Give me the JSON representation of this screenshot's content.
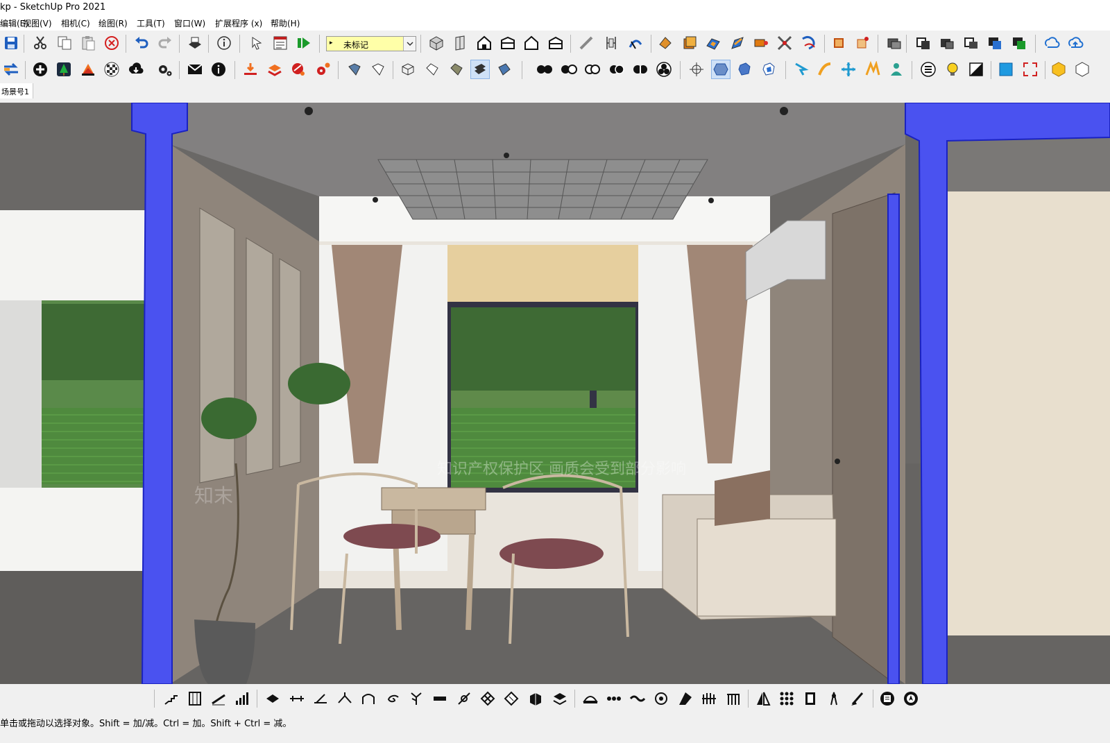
{
  "window": {
    "title": "kp - SketchUp Pro 2021"
  },
  "menu": {
    "items": [
      {
        "label": "编辑(E)"
      },
      {
        "label": "视图(V)"
      },
      {
        "label": "相机(C)"
      },
      {
        "label": "绘图(R)"
      },
      {
        "label": "工具(T)"
      },
      {
        "label": "窗口(W)"
      },
      {
        "label": "扩展程序 (x)"
      },
      {
        "label": "帮助(H)"
      }
    ]
  },
  "toolbar": {
    "layer_value": "未标记"
  },
  "scene_tabs": [
    {
      "label": "场景号1"
    }
  ],
  "viewport": {
    "watermark_banner": "知识产权保护区  画质会受到部分影响",
    "watermark_mark": "知末"
  },
  "status": {
    "text": "单击或拖动以选择对象。Shift = 加/减。Ctrl = 加。Shift + Ctrl = 减。"
  },
  "colors": {
    "selection_blue": "#4a52f0",
    "floor": "#6a6866",
    "ceiling": "#878583",
    "wall": "#8f857b",
    "curtain": "#a18776"
  }
}
